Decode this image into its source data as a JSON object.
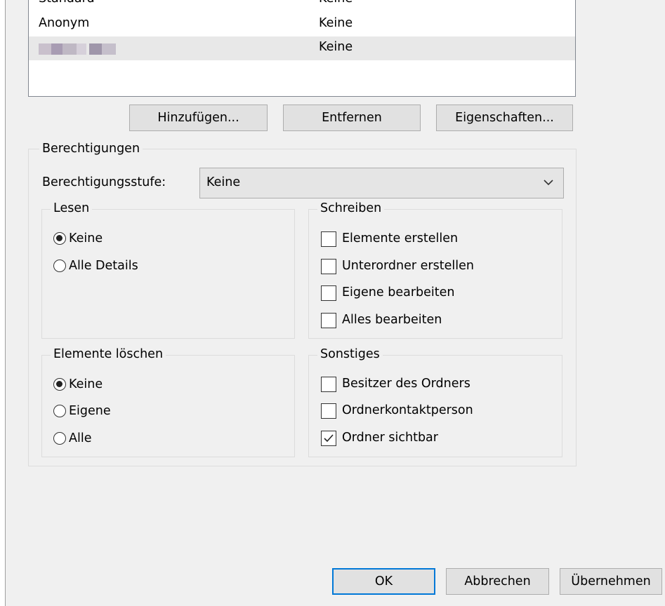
{
  "user_list": {
    "rows": [
      {
        "name": "Standard",
        "permission": "Keine"
      },
      {
        "name": "Anonym",
        "permission": "Keine"
      },
      {
        "name": "",
        "permission": "Keine",
        "name_obscured": true
      }
    ]
  },
  "list_buttons": {
    "add": "Hinzufügen...",
    "remove": "Entfernen",
    "properties": "Eigenschaften..."
  },
  "permissions": {
    "title": "Berechtigungen",
    "level_label": "Berechtigungsstufe:",
    "level_value": "Keine",
    "read": {
      "title": "Lesen",
      "options": [
        {
          "label": "Keine",
          "checked": true
        },
        {
          "label": "Alle Details",
          "checked": false
        }
      ]
    },
    "write": {
      "title": "Schreiben",
      "options": [
        {
          "label": "Elemente erstellen",
          "checked": false
        },
        {
          "label": "Unterordner erstellen",
          "checked": false
        },
        {
          "label": "Eigene bearbeiten",
          "checked": false
        },
        {
          "label": "Alles bearbeiten",
          "checked": false
        }
      ]
    },
    "delete": {
      "title": "Elemente löschen",
      "options": [
        {
          "label": "Keine",
          "checked": true
        },
        {
          "label": "Eigene",
          "checked": false
        },
        {
          "label": "Alle",
          "checked": false
        }
      ]
    },
    "other": {
      "title": "Sonstiges",
      "options": [
        {
          "label": "Besitzer des Ordners",
          "checked": false
        },
        {
          "label": "Ordnerkontaktperson",
          "checked": false
        },
        {
          "label": "Ordner sichtbar",
          "checked": true
        }
      ]
    }
  },
  "dialog_buttons": {
    "ok": "OK",
    "cancel": "Abbrechen",
    "apply": "Übernehmen"
  },
  "colors": {
    "accent": "#0078d7",
    "selected_row": "#e8e8e8",
    "button_bg": "#e1e1e1"
  }
}
